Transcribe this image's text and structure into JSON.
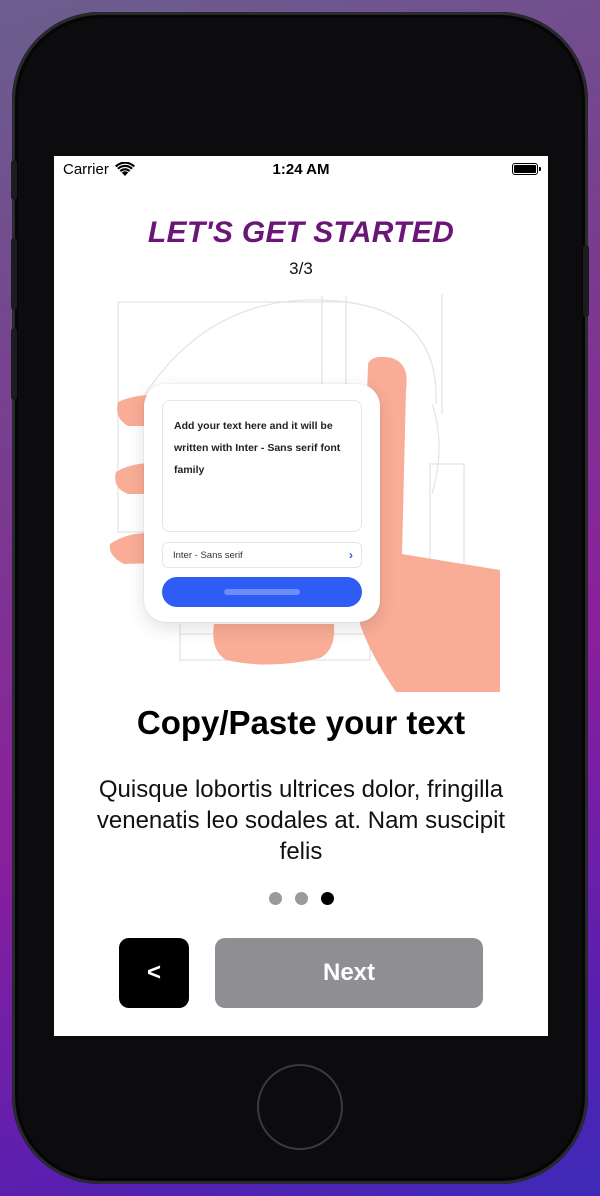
{
  "status_bar": {
    "carrier": "Carrier",
    "time": "1:24 AM",
    "icons": [
      "wifi-icon",
      "battery-icon"
    ]
  },
  "header": {
    "headline": "LET'S GET STARTED",
    "step": "3/3"
  },
  "illustration": {
    "card_text": "Add your text here and it will be written with Inter - Sans serif font family",
    "select_value": "Inter - Sans serif",
    "select_icon": "chevron-right-icon"
  },
  "content": {
    "title": "Copy/Paste your text",
    "description": "Quisque lobortis ultrices dolor, fringilla venenatis leo sodales at. Nam suscipit felis"
  },
  "pager": {
    "total": 3,
    "active_index": 2
  },
  "navigation": {
    "back_label": "<",
    "next_label": "Next"
  },
  "colors": {
    "headline": "#6a1577",
    "primary_blue": "#2f5cf5",
    "next_button": "#8e8e93",
    "back_button": "#000000",
    "hand": "#f9ad96"
  }
}
